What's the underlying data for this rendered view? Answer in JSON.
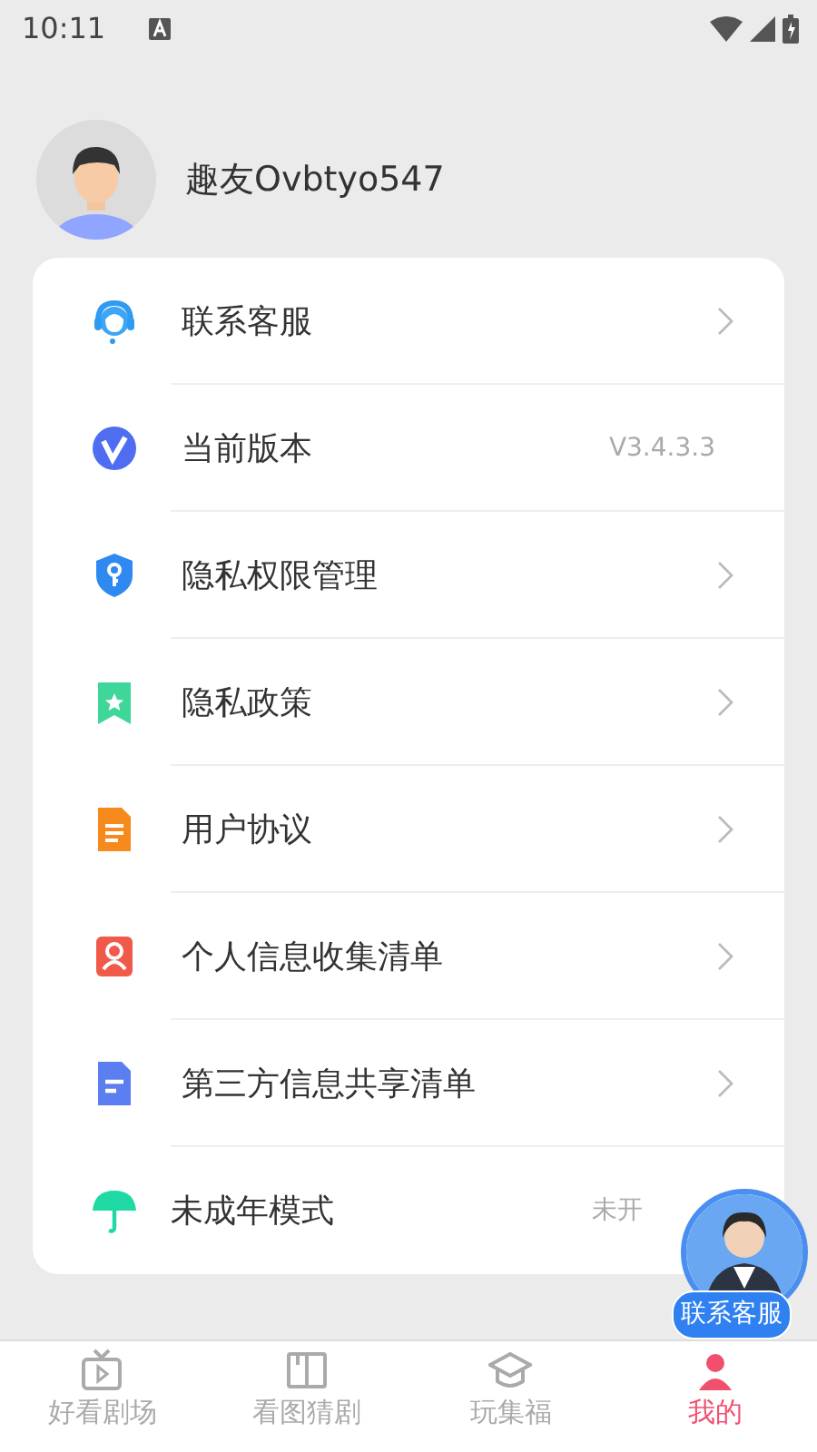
{
  "status_bar": {
    "time": "10:11"
  },
  "profile": {
    "username": "趣友Ovbtyo547"
  },
  "menu": [
    {
      "label": "联系客服",
      "kind": "link"
    },
    {
      "label": "当前版本",
      "kind": "value",
      "value": "V3.4.3.3"
    },
    {
      "label": "隐私权限管理",
      "kind": "link"
    },
    {
      "label": "隐私政策",
      "kind": "link"
    },
    {
      "label": "用户协议",
      "kind": "link"
    },
    {
      "label": "个人信息收集清单",
      "kind": "link"
    },
    {
      "label": "第三方信息共享清单",
      "kind": "link"
    },
    {
      "label": "未成年模式",
      "kind": "value",
      "value": "未开"
    }
  ],
  "floating_button": {
    "label": "联系客服"
  },
  "tabs": [
    {
      "label": "好看剧场",
      "selected": false
    },
    {
      "label": "看图猜剧",
      "selected": false
    },
    {
      "label": "玩集福",
      "selected": false
    },
    {
      "label": "我的",
      "selected": true
    }
  ]
}
